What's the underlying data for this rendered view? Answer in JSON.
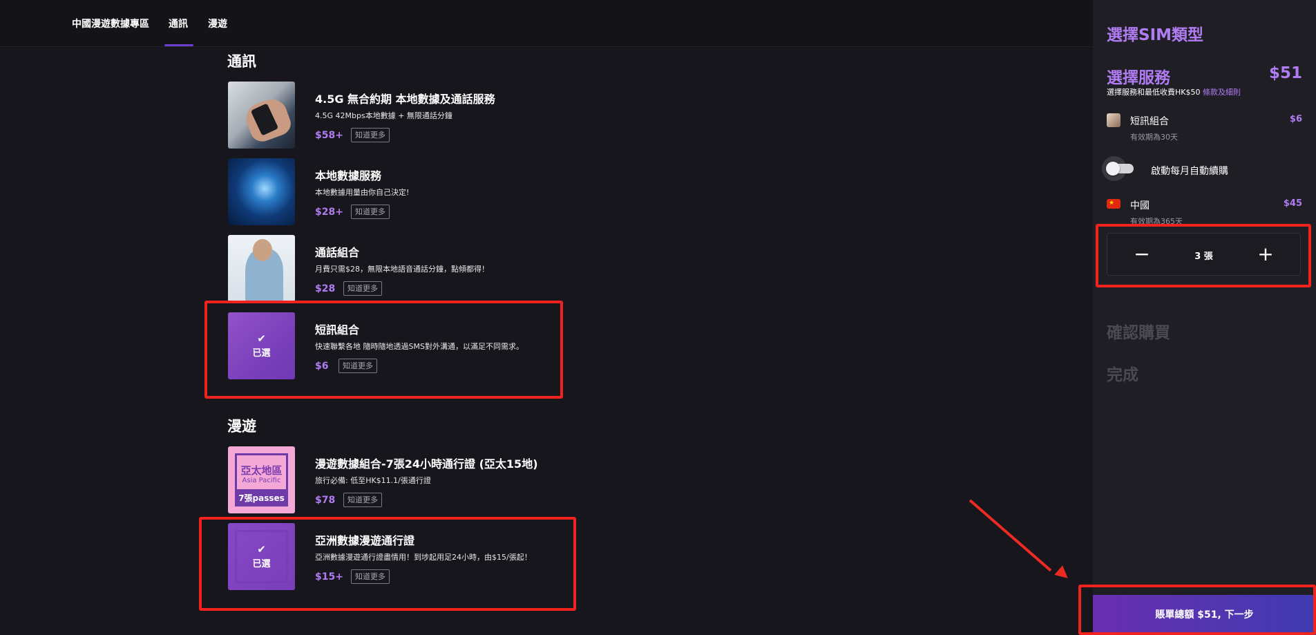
{
  "nav": {
    "items": [
      "中國漫遊數據專區",
      "通訊",
      "漫遊"
    ]
  },
  "sections": {
    "comm_title": "通訊",
    "roam_title": "漫遊"
  },
  "products": [
    {
      "name": "4.5G 無合約期 本地數據及通話服務",
      "desc": "4.5G 42Mbps本地數據 + 無限通話分鐘",
      "price": "$58+",
      "learn": "知道更多"
    },
    {
      "name": "本地數據服務",
      "desc": "本地數據用量由你自己決定!",
      "price": "$28+",
      "learn": "知道更多"
    },
    {
      "name": "通話組合",
      "desc": "月費只需$28，無限本地語音通話分鐘，點傾都得！",
      "price": "$28",
      "learn": "知道更多"
    },
    {
      "name": "短訊組合",
      "desc": "快速聯繫各地 隨時隨地透過SMS對外溝通，以滿足不同需求。",
      "price": "$6",
      "learn": "知道更多",
      "selected_label": "已選"
    },
    {
      "name": "漫遊數據組合-7張24小時通行證 (亞太15地)",
      "desc": "旅行必備: 低至HK$11.1/張通行證",
      "price": "$78",
      "learn": "知道更多",
      "thumb_text": [
        "亞太地區",
        "Asia Pacific",
        "7張passes"
      ]
    },
    {
      "name": "亞洲數據漫遊通行證",
      "desc": "亞洲數據漫遊通行證盡情用！到埗起用足24小時，由$15/張起！",
      "price": "$15+",
      "learn": "知道更多",
      "selected_label": "已選"
    }
  ],
  "panel": {
    "title": "選擇SIM類型",
    "service_title": "選擇服務",
    "service_total": "$51",
    "note": "選擇服務和最低收費HK$50 ",
    "note_link": "條款及細則",
    "items": [
      {
        "name": "短訊組合",
        "price": "$6",
        "valid": "有效期為30天",
        "icon": "sms-thumb-icon"
      },
      {
        "name": "中國",
        "price": "$45",
        "valid": "有效期為365天",
        "icon": "china-flag-icon"
      }
    ],
    "auto_renew_label": "啟動每月自動續購",
    "auto_renew_on": false,
    "quantity": "3 張",
    "step_confirm": "確認購買",
    "step_done": "完成",
    "next_button": "賬單總額 $51, 下一步"
  },
  "colors": {
    "accent": "#b07cf2",
    "annotation": "#f0231f",
    "button_gradient_start": "#6a2fb0",
    "button_gradient_end": "#3f3bb0"
  }
}
